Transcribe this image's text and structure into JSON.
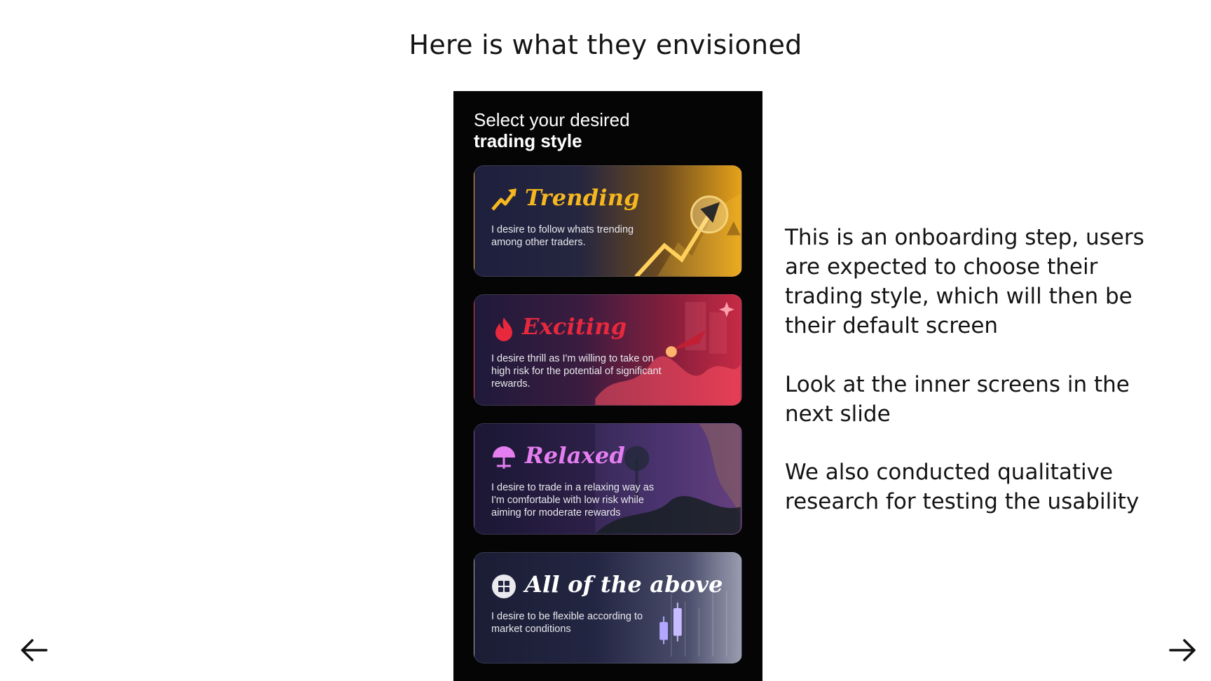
{
  "slide": {
    "title": "Here is what they envisioned"
  },
  "phone": {
    "heading_line1": "Select your desired",
    "heading_line2": "trading style",
    "cards": [
      {
        "title": "Trending",
        "description": "I desire to follow whats trending among other traders.",
        "icon": "trending-arrow-icon",
        "accent": "#f6b71e"
      },
      {
        "title": "Exciting",
        "description": "I desire thrill as I'm willing to take on high risk for the potential of significant rewards.",
        "icon": "flame-icon",
        "accent": "#e8283d"
      },
      {
        "title": "Relaxed",
        "description": "I desire to trade in a relaxing way as I'm comfortable with low risk while aiming for moderate rewards",
        "icon": "beach-umbrella-icon",
        "accent": "#e57ef0"
      },
      {
        "title": "All of the above",
        "description": "I desire to be flexible according to market conditions",
        "icon": "grid-icon",
        "accent": "#ffffff"
      }
    ]
  },
  "notes": {
    "paragraph1": "This is an onboarding step, users are expected to choose their trading style, which will then be their default screen",
    "paragraph2": "Look at the inner screens in the next slide",
    "paragraph3": "We also conducted qualitative research for testing the usability"
  },
  "navigation": {
    "prev_icon": "arrow-left-icon",
    "next_icon": "arrow-right-icon"
  }
}
